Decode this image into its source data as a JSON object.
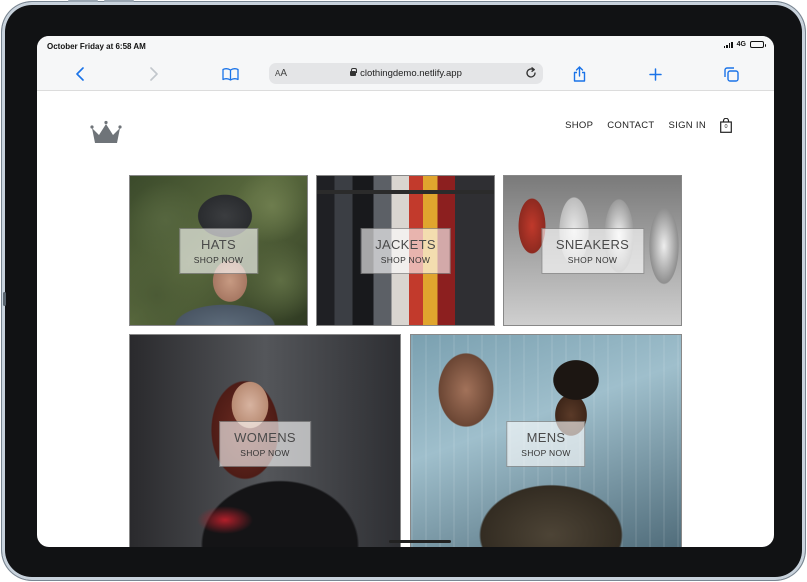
{
  "status_bar": {
    "time": "October Friday at 6:58 AM",
    "network": "4G",
    "battery_level": 0.85
  },
  "browser": {
    "url": "clothingdemo.netlify.app",
    "text_size_label_small": "A",
    "text_size_label_large": "A",
    "icons": [
      "back-icon",
      "forward-icon",
      "bookmarks-icon",
      "lock-icon",
      "reload-icon",
      "share-icon",
      "new-tab-icon",
      "tabs-icon"
    ]
  },
  "site": {
    "logo": "crown-icon",
    "nav": {
      "shop": "SHOP",
      "contact": "CONTACT",
      "sign_in": "SIGN IN",
      "cart_count": "0"
    },
    "categories": [
      {
        "title": "HATS",
        "cta": "SHOP NOW"
      },
      {
        "title": "JACKETS",
        "cta": "SHOP NOW"
      },
      {
        "title": "SNEAKERS",
        "cta": "SHOP NOW"
      },
      {
        "title": "WOMENS",
        "cta": "SHOP NOW"
      },
      {
        "title": "MENS",
        "cta": "SHOP NOW"
      }
    ]
  },
  "colors": {
    "device_frame": "#111214",
    "browser_accent": "#1a73e8",
    "text_dark": "#222222"
  }
}
